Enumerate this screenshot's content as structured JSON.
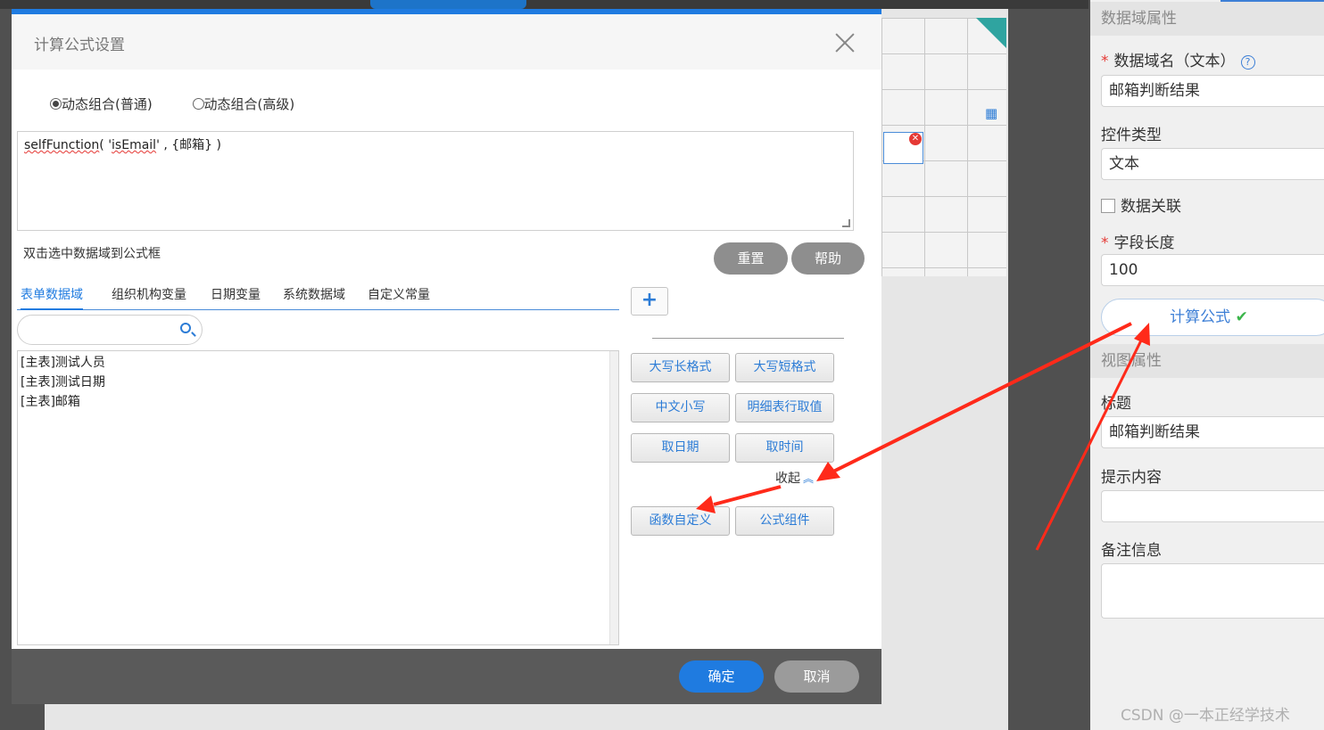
{
  "dialog": {
    "title": "计算公式设置",
    "radio_normal": "动态组合(普通)",
    "radio_advanced": "动态组合(高级)",
    "formula_part1": "selfFunction",
    "formula_part2": "( '",
    "formula_part3": "isEmail",
    "formula_part4": "' , {邮箱} )",
    "hint": "双击选中数据域到公式框",
    "reset_label": "重置",
    "help_label": "帮助",
    "tabs": [
      "表单数据域",
      "组织机构变量",
      "日期变量",
      "系统数据域",
      "自定义常量"
    ],
    "fields": [
      "[主表]测试人员",
      "[主表]测试日期",
      "[主表]邮箱"
    ],
    "plus_label": "+",
    "func_buttons": [
      "大写长格式",
      "大写短格式",
      "中文小写",
      "明细表行取值",
      "取日期",
      "取时间",
      "函数自定义",
      "公式组件"
    ],
    "collapse_label": "收起",
    "ok_label": "确定",
    "cancel_label": "取消"
  },
  "panel": {
    "section_data": "数据域属性",
    "name_label": "数据域名（文本）",
    "name_value": "邮箱判断结果",
    "control_type_label": "控件类型",
    "control_type_value": "文本",
    "data_link_label": "数据关联",
    "field_length_label": "字段长度",
    "field_length_value": "100",
    "calc_label": "计算公式",
    "section_view": "视图属性",
    "title_label": "标题",
    "title_value": "邮箱判断结果",
    "tip_label": "提示内容",
    "remark_label": "备注信息"
  },
  "watermark": "CSDN @一本正经学技术",
  "colors": {
    "accent": "#1f7be0",
    "arrow": "#ff2a1a",
    "check": "#3bb54a"
  }
}
